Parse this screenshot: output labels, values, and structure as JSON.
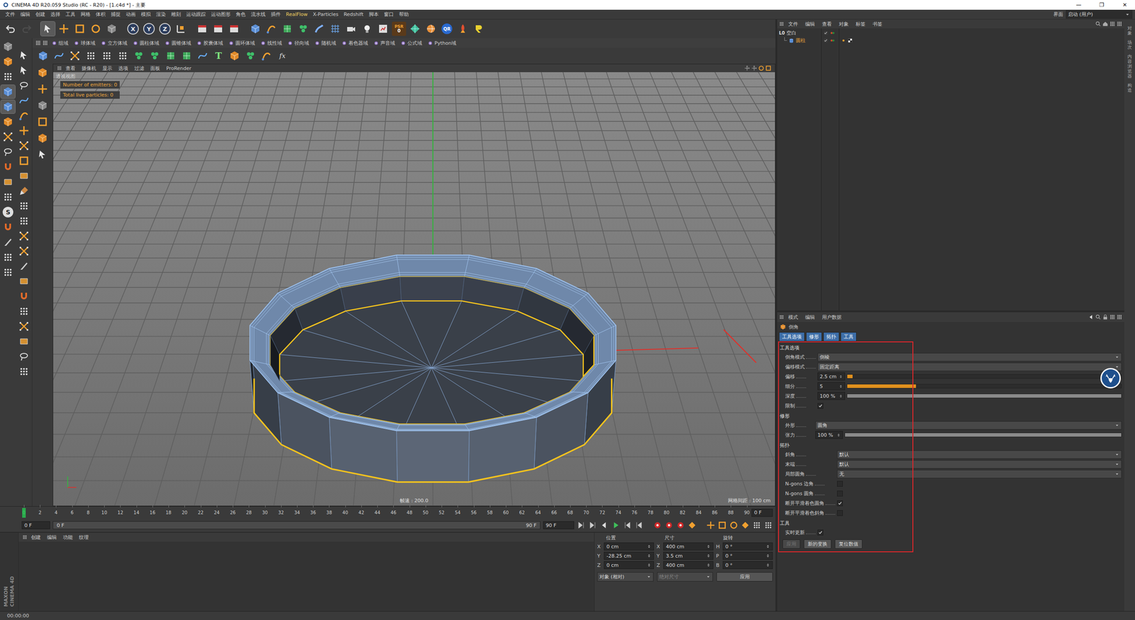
{
  "window": {
    "title": "CINEMA 4D R20.059 Studio (RC - R20) - [1.c4d *] - 主要",
    "controls": [
      "—",
      "❐",
      "✕"
    ]
  },
  "menubar": {
    "items": [
      "文件",
      "编辑",
      "创建",
      "选择",
      "工具",
      "网格",
      "体积",
      "捕捉",
      "动画",
      "模拟",
      "渲染",
      "雕刻",
      "运动跟踪",
      "运动图形",
      "角色",
      "流水线",
      "插件",
      "RealFlow",
      "X-Particles",
      "Redshift",
      "脚本",
      "窗口",
      "帮助"
    ],
    "layout_label": "界面",
    "layout_value": "启动 (用户)"
  },
  "toolbar": {
    "undo_enabled": true,
    "redo_enabled": false,
    "select_active": true,
    "axes": [
      "X",
      "Y",
      "Z"
    ],
    "psr_label": "PSR",
    "psr_value": "0",
    "qr": "QR"
  },
  "fields_bar": [
    "组域",
    "球体域",
    "立方体域",
    "圆柱体域",
    "圆锥体域",
    "胶囊体域",
    "圆环体域",
    "线性域",
    "径向域",
    "随机域",
    "着色器域",
    "声音域",
    "公式域",
    "Python域"
  ],
  "tool_row": {
    "text_tool": "T",
    "fx": "fx"
  },
  "left_toolbar": {
    "snap_letter": "S"
  },
  "viewport": {
    "menu": [
      "查看",
      "摄像机",
      "显示",
      "选项",
      "过滤",
      "面板",
      "ProRender"
    ],
    "view_name": "透视视图",
    "hud": [
      "Number of emitters: 0",
      "Total live particles: 0"
    ],
    "fps": "帧速 : 200.0",
    "grid_spacing": "网格间距 : 100 cm"
  },
  "timeline": {
    "ticks": [
      "0",
      "2",
      "4",
      "6",
      "8",
      "10",
      "12",
      "14",
      "16",
      "18",
      "20",
      "22",
      "24",
      "26",
      "28",
      "30",
      "32",
      "34",
      "36",
      "38",
      "40",
      "42",
      "44",
      "46",
      "48",
      "50",
      "52",
      "54",
      "56",
      "58",
      "60",
      "62",
      "64",
      "66",
      "68",
      "70",
      "72",
      "74",
      "76",
      "78",
      "80",
      "82",
      "84",
      "86",
      "88",
      "90"
    ],
    "playhead_level": 0,
    "current_field": "0 F",
    "start_field": "0 F",
    "range_start": "0 F",
    "range_end": "90 F",
    "end_field": "90 F"
  },
  "materials": {
    "menu": [
      "创建",
      "编辑",
      "功能",
      "纹理"
    ],
    "logo": [
      "MAXON",
      "CINEMA 4D"
    ]
  },
  "coordinates": {
    "headers": [
      "位置",
      "尺寸",
      "旋转"
    ],
    "rows": [
      {
        "pos_axis": "X",
        "pos": "0 cm",
        "size_axis": "X",
        "size": "400 cm",
        "rot_axis": "H",
        "rot": "0 °"
      },
      {
        "pos_axis": "Y",
        "pos": "-28.25 cm",
        "size_axis": "Y",
        "size": "3.5 cm",
        "rot_axis": "P",
        "rot": "0 °"
      },
      {
        "pos_axis": "Z",
        "pos": "0 cm",
        "size_axis": "Z",
        "size": "400 cm",
        "rot_axis": "B",
        "rot": "0 °"
      }
    ],
    "mode": "对象 (相对)",
    "size_mode": "绝对尺寸",
    "apply": "应用"
  },
  "objects": {
    "menu": [
      "文件",
      "编辑",
      "查看",
      "对象",
      "标签",
      "书签"
    ],
    "items": [
      {
        "name": "空白",
        "icon_text": "L0",
        "depth": 0,
        "selected": false
      },
      {
        "name": "圆柱",
        "depth": 1,
        "selected": true
      }
    ]
  },
  "attributes": {
    "menu": [
      "模式",
      "编辑",
      "用户数据"
    ],
    "title": "倒角",
    "tabs": [
      {
        "label": "工具选项",
        "selected": true
      },
      {
        "label": "修形",
        "selected": true
      },
      {
        "label": "拓扑",
        "selected": true
      },
      {
        "label": "工具",
        "selected": true
      }
    ],
    "sections": [
      {
        "title": "工具选项",
        "rows": [
          {
            "kind": "dropdown",
            "label": "倒角模式",
            "value": "倒棱"
          },
          {
            "kind": "dropdown",
            "label": "偏移模式",
            "value": "固定距离"
          },
          {
            "kind": "slider",
            "label": "偏移",
            "value": "2.5 cm",
            "level": 0.02,
            "color": "#e0901e"
          },
          {
            "kind": "slider",
            "label": "细分",
            "value": "5",
            "level": 0.25,
            "color": "#e0901e"
          },
          {
            "kind": "slider",
            "label": "深度",
            "value": "100 %",
            "level": 1,
            "color": "#8a8a8a"
          },
          {
            "kind": "check",
            "label": "限制",
            "checked": true
          }
        ]
      },
      {
        "title": "修形",
        "rows": [
          {
            "kind": "dropdown",
            "label": "外形",
            "value": "圆角"
          },
          {
            "kind": "slider",
            "label": "张力",
            "value": "100 %",
            "level": 1,
            "color": "#8a8a8a"
          }
        ]
      },
      {
        "title": "拓扑",
        "rows": [
          {
            "kind": "dropdown",
            "label": "斜角",
            "value": "默认"
          },
          {
            "kind": "dropdown",
            "label": "末端",
            "value": "默认"
          },
          {
            "kind": "dropdown",
            "label": "局部圆角",
            "value": "无"
          },
          {
            "kind": "check",
            "label": "N-gons 边角",
            "checked": false
          },
          {
            "kind": "check",
            "label": "N-gons 圆角",
            "checked": false
          },
          {
            "kind": "check",
            "label": "断开平滑着色圆角",
            "checked": true
          },
          {
            "kind": "check",
            "label": "断开平滑着色斜角",
            "checked": false
          }
        ]
      },
      {
        "title": "工具",
        "rows": [
          {
            "kind": "check",
            "label": "实时更新",
            "checked": true
          }
        ]
      }
    ],
    "buttons": [
      {
        "label": "应用",
        "disabled": true
      },
      {
        "label": "新的变换",
        "disabled": false
      },
      {
        "label": "复位数值",
        "disabled": false
      }
    ]
  },
  "side_tabs": [
    "对象",
    "场次",
    "内容浏览器",
    "构造"
  ],
  "status_bar": "00:00:00"
}
